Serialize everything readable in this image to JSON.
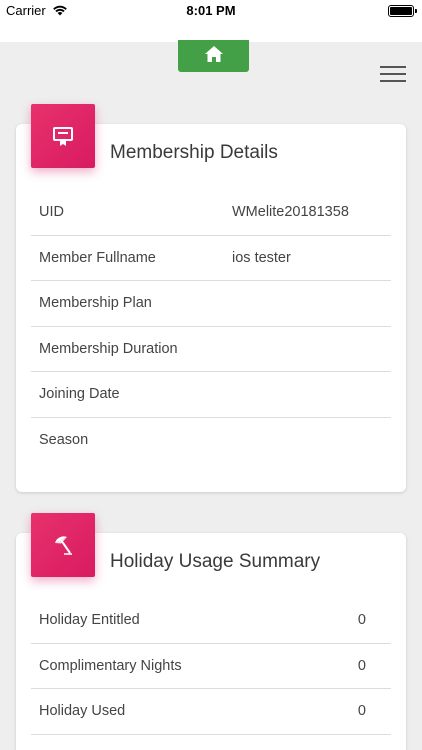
{
  "status_bar": {
    "carrier": "Carrier",
    "time": "8:01 PM"
  },
  "nav": {
    "home_icon": "home-icon",
    "menu_icon": "hamburger-menu-icon"
  },
  "membership": {
    "title": "Membership Details",
    "icon": "membership-card-icon",
    "rows": [
      {
        "label": "UID",
        "value": "WMelite20181358"
      },
      {
        "label": "Member Fullname",
        "value": "ios tester"
      },
      {
        "label": "Membership Plan",
        "value": ""
      },
      {
        "label": "Membership Duration",
        "value": ""
      },
      {
        "label": "Joining Date",
        "value": ""
      },
      {
        "label": "Season",
        "value": ""
      }
    ]
  },
  "holiday": {
    "title": "Holiday Usage Summary",
    "icon": "beach-umbrella-icon",
    "rows": [
      {
        "label": "Holiday Entitled",
        "value": "0"
      },
      {
        "label": "Complimentary Nights",
        "value": "0"
      },
      {
        "label": "Holiday Used",
        "value": "0"
      }
    ]
  },
  "colors": {
    "accent": "#d81b60",
    "home_button": "#43a047",
    "background": "#eeeeee"
  }
}
